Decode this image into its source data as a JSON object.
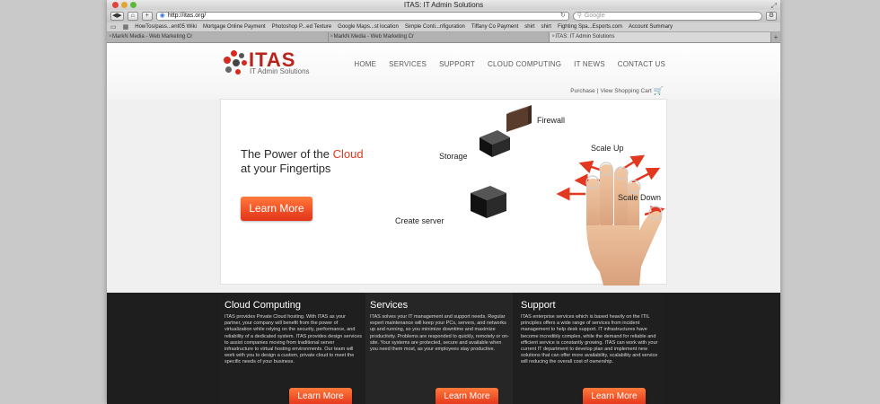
{
  "browser": {
    "window_title": "ITAS: IT Admin Solutions",
    "url": "http://itas.org/",
    "search_placeholder": "Google",
    "bookmarks": [
      "HowTos/pass...ent05 Wiki",
      "Mortgage Online Payment",
      "Photoshop P...ed Texture",
      "Google Maps...st location",
      "Simple Conti...nfiguration",
      "Tiffany Co Payment",
      "shirt",
      "shirt",
      "Fighting Spa...Esports.com",
      "Account Summary"
    ],
    "tabs": [
      {
        "label": "MarkN Media - Web Marketing Cr",
        "active": false
      },
      {
        "label": "MarkN Media - Web Marketing Cr",
        "active": false
      },
      {
        "label": "ITAS: IT Admin Solutions",
        "active": true
      }
    ]
  },
  "site": {
    "logo": {
      "title": "ITAS",
      "subtitle": "IT Admin Solutions"
    },
    "nav": [
      "HOME",
      "SERVICES",
      "SUPPORT",
      "CLOUD COMPUTING",
      "IT NEWS",
      "CONTACT US"
    ],
    "cart": {
      "purchase": "Purchase",
      "separator": "|",
      "view_cart": "View Shopping Cart"
    },
    "hero": {
      "headline_pre": "The Power of the ",
      "headline_accent": "Cloud",
      "headline_post": "at your Fingertips",
      "button": "Learn More",
      "labels": {
        "firewall": "Firewall",
        "storage": "Storage",
        "scale_up": "Scale Up",
        "scale_down": "Scale Down",
        "create_server": "Create server"
      }
    },
    "footer": [
      {
        "title": "Cloud Computing",
        "text": "ITAS provides Private Cloud hosting. With ITAS as your partner, your company will benefit from the power of virtualization while relying on the security, performance, and reliability of a dedicated system. ITAS provides design services to assist companies moving from traditional server infrastructure to virtual hosting environments. Our team will work with you to design a custom, private cloud to meet the specific needs of your business.",
        "button": "Learn More"
      },
      {
        "title": "Services",
        "text": "ITAS solves your IT management and support needs. Regular expert maintenance will keep your PCs, servers, and networks up and running, so you minimize downtime and maximize productivity. Problems are responded to quickly, remotely or on-site. Your systems are protected, secure and available when you need them most, as your employees stay productive.",
        "button": "Learn More"
      },
      {
        "title": "Support",
        "text": "ITAS enterprise services which is based heavily on the ITIL principles offers a wide range of services from incident management to help desk support. IT infrastructures have become incredibly complex, while the demand for reliable and efficient service is constantly growing. ITAS can work with your current IT department to develop plan and implement new solutions that can offer more availability, scalability and service will reducing the overall cost of ownership.",
        "button": "Learn More"
      }
    ]
  },
  "colors": {
    "accent": "#e2381f",
    "footer_bg": "#1e1e1e"
  }
}
